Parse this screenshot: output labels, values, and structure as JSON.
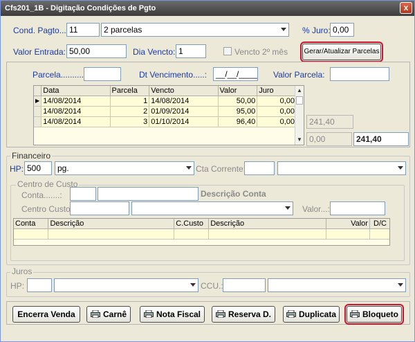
{
  "window": {
    "title": "Cfs201_1B - Digitação Condições de Pgto",
    "close": "x"
  },
  "top": {
    "cond_pagto_label": "Cond. Pagto...:",
    "cond_pagto_code": "11",
    "cond_pagto_desc": "2 parcelas",
    "juro_label": "% Juro:",
    "juro_value": "0,00",
    "valor_entrada_label": "Valor Entrada:",
    "valor_entrada_value": "50,00",
    "dia_vencto_label": "Dia Vencto:",
    "dia_vencto_value": "1",
    "vencto_2_mes_label": "Vencto 2º mês",
    "gerar_button": "Gerar/Atualizar Parcelas"
  },
  "parcelas": {
    "parcela_label": "Parcela..........:",
    "parcela_value": "",
    "dt_vencimento_label": "Dt Vencimento.....:",
    "dt_vencimento_value": "__/__/____",
    "valor_parcela_label": "Valor Parcela:",
    "valor_parcela_value": "",
    "columns": [
      "Data",
      "Parcela",
      "Vencto",
      "Valor",
      "Juro"
    ],
    "rows": [
      {
        "data": "14/08/2014",
        "parcela": "1",
        "vencto": "14/08/2014",
        "valor": "50,00",
        "juro": "0,00"
      },
      {
        "data": "14/08/2014",
        "parcela": "2",
        "vencto": "01/09/2014",
        "valor": "95,00",
        "juro": "0,00"
      },
      {
        "data": "14/08/2014",
        "parcela": "3",
        "vencto": "01/10/2014",
        "valor": "96,40",
        "juro": "0,00"
      }
    ],
    "subtotal": "241,40",
    "juro_total": "0,00",
    "total": "241,40"
  },
  "financeiro": {
    "legend": "Financeiro",
    "hp_label": "HP:",
    "hp_code": "500",
    "hp_desc": "pg.",
    "cta_corrente_label": "Cta Corrente:",
    "centro_custo": {
      "legend": "Centro de Custo",
      "conta_label": "Conta.......:",
      "descricao_conta_label": "Descrição Conta",
      "centro_custo_label": "Centro Custo:",
      "valor_label": "Valor...:",
      "columns": [
        "Conta",
        "Descrição",
        "C.Custo",
        "Descrição",
        "Valor",
        "D/C"
      ]
    }
  },
  "juros": {
    "legend": "Juros",
    "hp_label": "HP:",
    "ccu_label": "CCU.:"
  },
  "buttons": {
    "encerra_venda": "Encerra Venda",
    "carne": "Carnê",
    "nota_fiscal": "Nota Fiscal",
    "reserva": "Reserva D.",
    "duplicata": "Duplicata",
    "bloqueto": "Bloqueto"
  },
  "colors": {
    "highlight": "#d0112b",
    "label_blue": "#1a3aa8",
    "grid_row": "#fffdd8"
  }
}
